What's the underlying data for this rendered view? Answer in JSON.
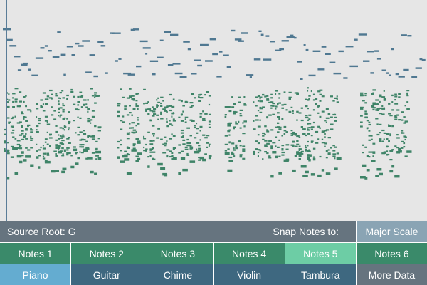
{
  "header": {
    "source_root_label": "Source Root: G",
    "snap_label": "Snap Notes to:",
    "scale_button": "Major Scale"
  },
  "notes_buttons": [
    {
      "label": "Notes 1",
      "active": false
    },
    {
      "label": "Notes 2",
      "active": false
    },
    {
      "label": "Notes 3",
      "active": false
    },
    {
      "label": "Notes 4",
      "active": false
    },
    {
      "label": "Notes 5",
      "active": true
    },
    {
      "label": "Notes 6",
      "active": false
    }
  ],
  "instrument_buttons": [
    {
      "label": "Piano",
      "active": true
    },
    {
      "label": "Guitar",
      "active": false
    },
    {
      "label": "Chime",
      "active": false
    },
    {
      "label": "Violin",
      "active": false
    },
    {
      "label": "Tambura",
      "active": false
    }
  ],
  "more_button": "More Data",
  "colors": {
    "background": "#e6e6e6",
    "melody_note": "#4f7891",
    "harmony_note": "#3f8468",
    "active_notes": "#6dcda5",
    "active_instrument": "#64acd0"
  }
}
